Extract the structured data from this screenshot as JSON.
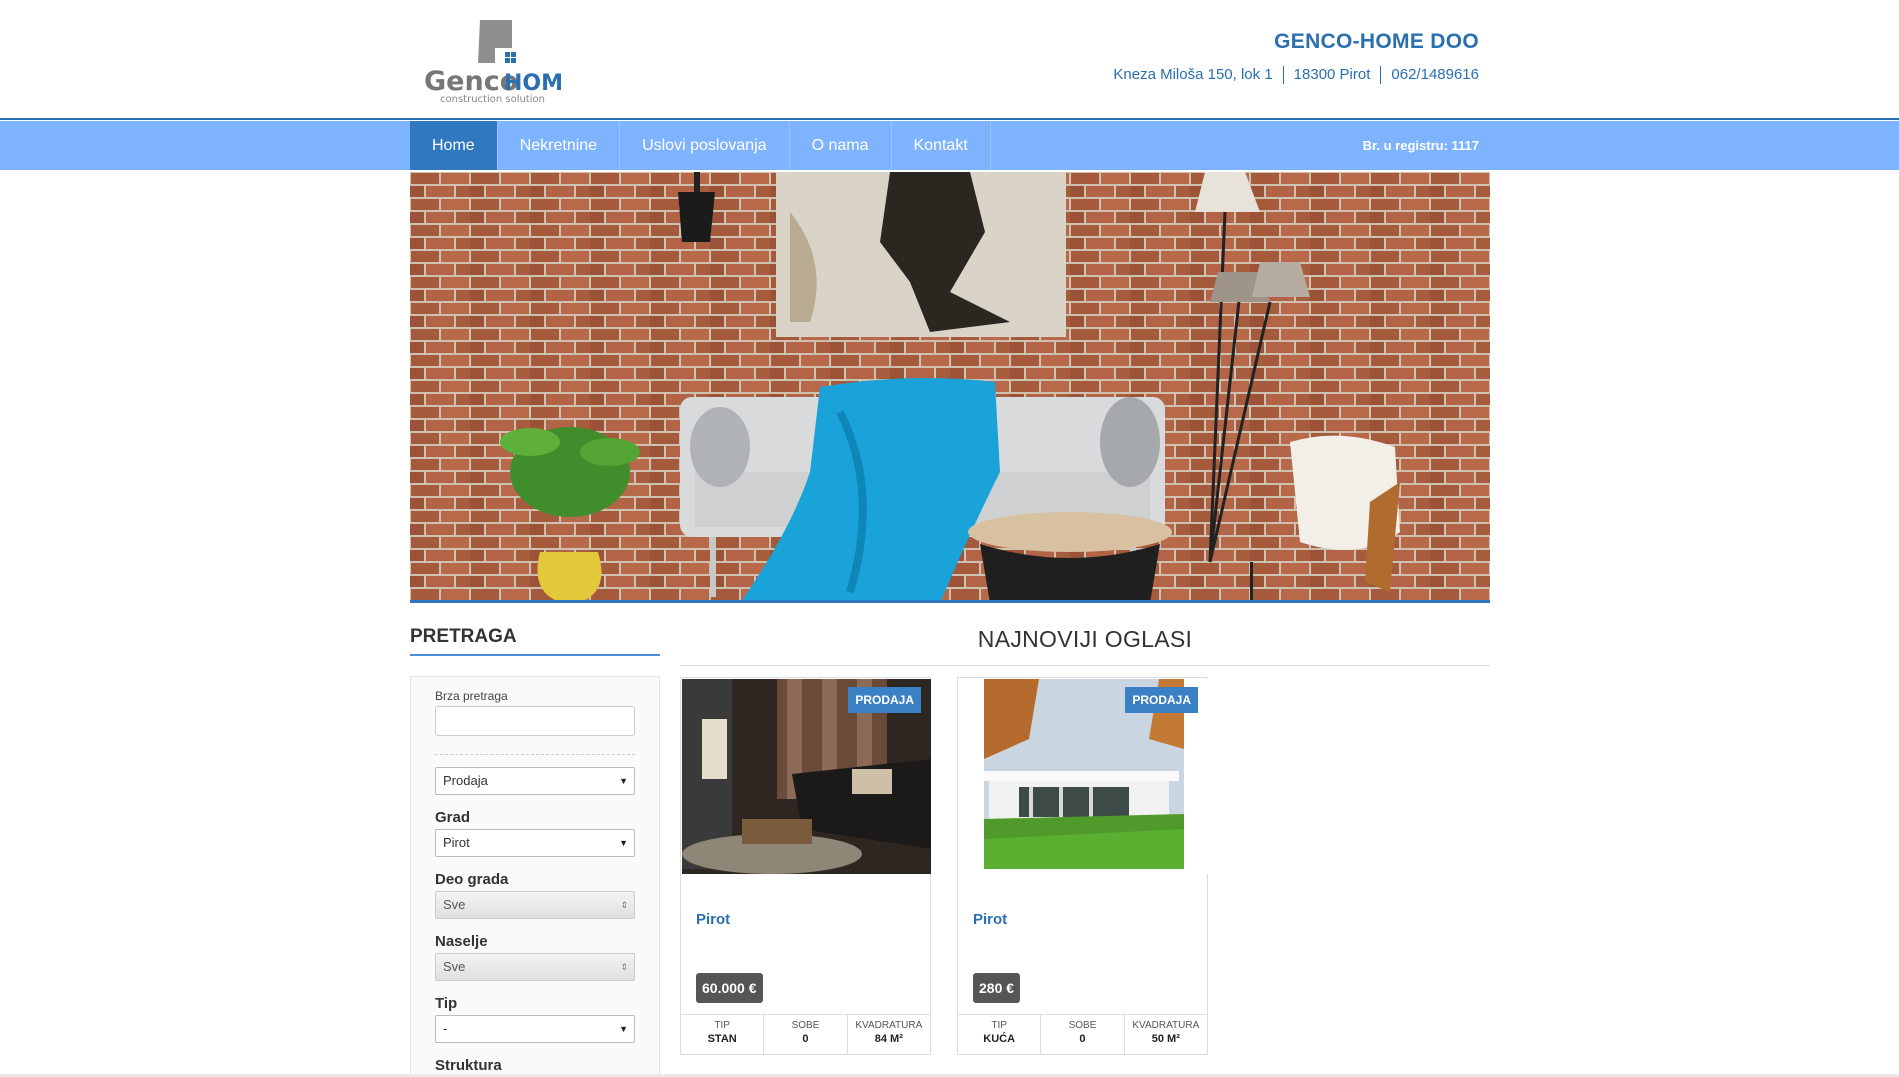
{
  "header": {
    "logo_word1": "Genco",
    "logo_word2": "HOME",
    "logo_tagline": "construction solution",
    "company_name": "GENCO-HOME DOO",
    "address": "Kneza Miloša 150, lok 1",
    "city": "18300 Pirot",
    "phone": "062/1489616"
  },
  "nav": {
    "items": [
      {
        "label": "Home",
        "active": true
      },
      {
        "label": "Nekretnine"
      },
      {
        "label": "Uslovi poslovanja"
      },
      {
        "label": "O nama"
      },
      {
        "label": "Kontakt"
      }
    ],
    "registry": "Br. u registru: 1117"
  },
  "sidebar": {
    "title": "PRETRAGA",
    "quick_search_label": "Brza pretraga",
    "quick_search_value": "",
    "offer_type": "Prodaja",
    "city_label": "Grad",
    "city_value": "Pirot",
    "district_label": "Deo grada",
    "district_value": "Sve",
    "settlement_label": "Naselje",
    "settlement_value": "Sve",
    "type_label": "Tip",
    "type_value": "-",
    "structure_label": "Struktura"
  },
  "listings": {
    "title": "NAJNOVIJI OGLASI",
    "cards": [
      {
        "badge": "PRODAJA",
        "city": "Pirot",
        "price": "60.000 €",
        "stats": [
          {
            "label": "TIP",
            "value": "STAN"
          },
          {
            "label": "SOBE",
            "value": "0"
          },
          {
            "label": "KVADRATURA",
            "value": "84 M²"
          }
        ]
      },
      {
        "badge": "PRODAJA",
        "city": "Pirot",
        "price": "280 €",
        "stats": [
          {
            "label": "TIP",
            "value": "KUĆA"
          },
          {
            "label": "SOBE",
            "value": "0"
          },
          {
            "label": "KVADRATURA",
            "value": "50 M²"
          }
        ]
      }
    ]
  },
  "colors": {
    "brand_blue": "#2a6fb0",
    "nav_bg": "#7eb3ff",
    "nav_active": "#2f78c0"
  }
}
